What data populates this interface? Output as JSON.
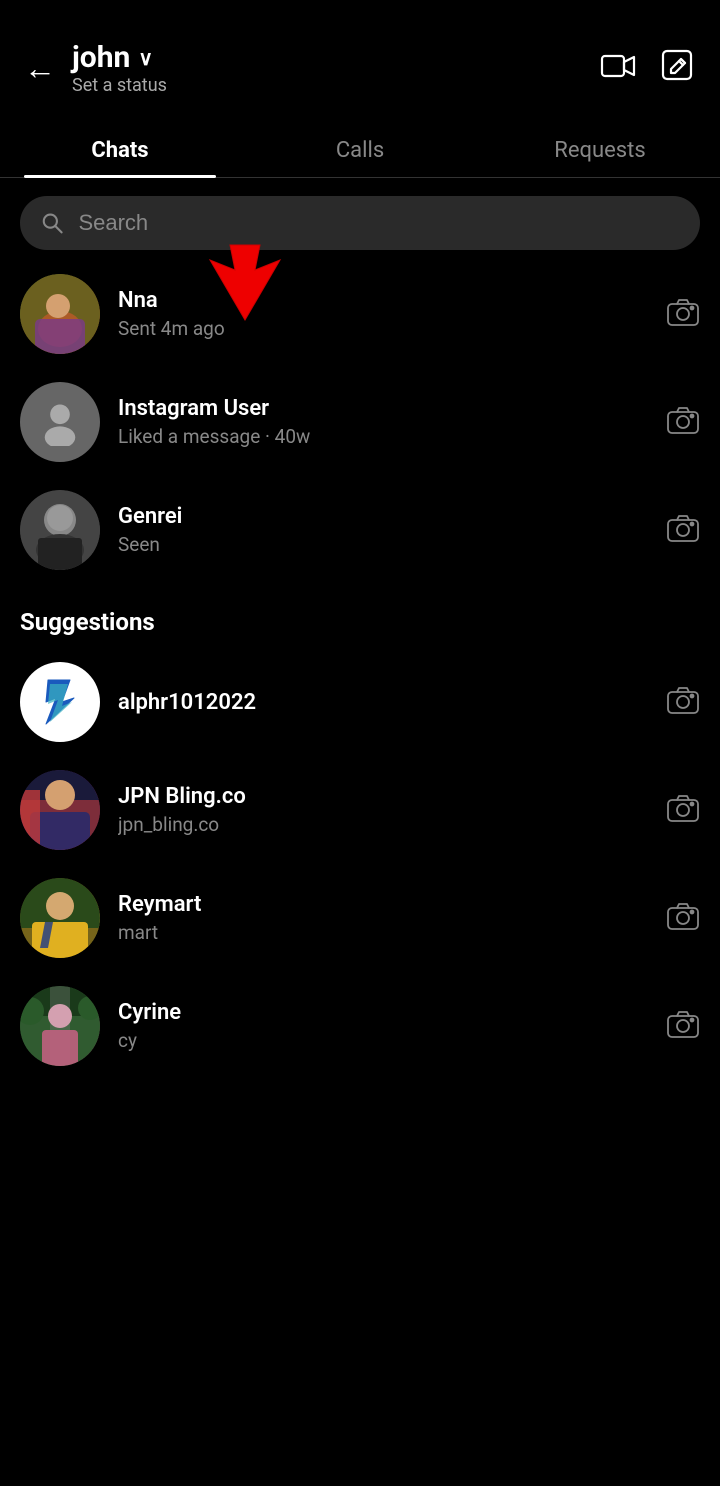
{
  "header": {
    "back_label": "←",
    "username": "john",
    "chevron": "∨",
    "status": "Set a status",
    "video_icon": "video-camera-icon",
    "compose_icon": "compose-icon"
  },
  "tabs": [
    {
      "label": "Chats",
      "active": true
    },
    {
      "label": "Calls",
      "active": false
    },
    {
      "label": "Requests",
      "active": false
    }
  ],
  "search": {
    "placeholder": "Search"
  },
  "chats": [
    {
      "name": "Nna",
      "sub": "Sent 4m ago",
      "avatar_type": "photo",
      "avatar_class": "avatar-nna",
      "camera": true
    },
    {
      "name": "Instagram User",
      "sub": "Liked a message · 40w",
      "avatar_type": "placeholder",
      "avatar_class": "",
      "camera": true
    },
    {
      "name": "Genrei",
      "sub": "Seen",
      "avatar_type": "photo",
      "avatar_class": "avatar-genrei",
      "camera": true
    }
  ],
  "suggestions_label": "Suggestions",
  "suggestions": [
    {
      "name": "alphr1012022",
      "sub": "",
      "avatar_type": "logo",
      "avatar_class": "avatar-alphr",
      "camera": true
    },
    {
      "name": "JPN Bling.co",
      "sub": "jpn_bling.co",
      "avatar_type": "photo",
      "avatar_class": "avatar-jpn",
      "camera": true
    },
    {
      "name": "Reymart",
      "sub": "mart",
      "avatar_type": "photo",
      "avatar_class": "avatar-reymart",
      "camera": true
    },
    {
      "name": "Cyrine",
      "sub": "cy",
      "avatar_type": "photo",
      "avatar_class": "avatar-cyrine",
      "camera": true
    }
  ]
}
